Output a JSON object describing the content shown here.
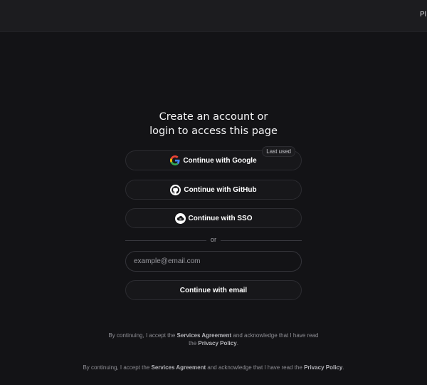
{
  "topbar": {
    "link_label": "Pl"
  },
  "auth": {
    "heading_line1": "Create an account or",
    "heading_line2": "login to access this page",
    "google_label": "Continue with Google",
    "last_used_badge": "Last used",
    "github_label": "Continue with GitHub",
    "sso_label": "Continue with SSO",
    "divider_text": "or",
    "email_placeholder": "example@email.com",
    "email_value": "",
    "email_button_label": "Continue with email"
  },
  "legal": {
    "prefix": "By continuing, I accept the",
    "services_agreement": "Services Agreement",
    "middle": "and acknowledge that I have read the",
    "privacy_policy": "Privacy Policy",
    "suffix": "."
  },
  "colors": {
    "background": "#131316",
    "topbar": "#1c1c1f",
    "button_border": "#2c2c31",
    "text": "#ffffff",
    "muted_text": "#8e8e94"
  },
  "icons": {
    "google": "google-logo-icon",
    "github": "github-logo-icon",
    "sso": "cloud-key-icon"
  }
}
